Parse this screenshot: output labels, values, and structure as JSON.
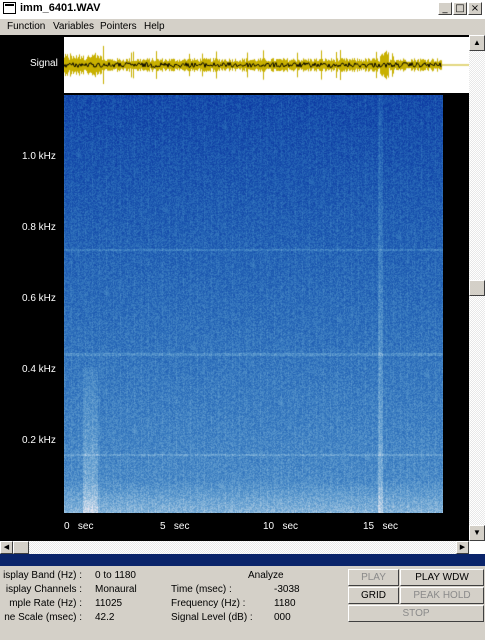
{
  "window": {
    "title": "imm_6401.WAV",
    "controls": {
      "minimize": "_",
      "maximize": "□",
      "close": "×"
    }
  },
  "menu": [
    {
      "label": "Function"
    },
    {
      "label": "Variables"
    },
    {
      "label": "Pointers"
    },
    {
      "label": "Help"
    }
  ],
  "plot": {
    "signal_label": "Signal",
    "y_ticks": [
      "1.0 kHz",
      "0.8 kHz",
      "0.6 kHz",
      "0.4 kHz",
      "0.2 kHz"
    ],
    "x_ticks": [
      "0   sec",
      "5   sec",
      "10   sec",
      "15   sec"
    ]
  },
  "chart_data": {
    "type": "heatmap",
    "title": "",
    "xlabel": "",
    "ylabel": "",
    "x_unit": "sec",
    "y_unit": "kHz",
    "xlim": [
      0,
      19
    ],
    "ylim": [
      0,
      1.18
    ],
    "x_ticks": [
      0,
      5,
      10,
      15
    ],
    "y_ticks": [
      0.2,
      0.4,
      0.6,
      0.8,
      1.0
    ]
  },
  "info": {
    "display_band_label": "isplay Band (Hz) :",
    "display_band_value": "0 to 1180",
    "display_channels_label": "isplay Channels :",
    "display_channels_value": "Monaural",
    "sample_rate_label": "mple Rate (Hz) :",
    "sample_rate_value": "11025",
    "time_scale_label": "ne Scale (msec) :",
    "time_scale_value": "42.2"
  },
  "analyze": {
    "title": "Analyze",
    "time_label": "Time (msec) :",
    "time_value": "-3038",
    "frequency_label": "Frequency (Hz) :",
    "frequency_value": "1180",
    "signal_level_label": "Signal Level (dB) :",
    "signal_level_value": "000"
  },
  "controls": {
    "play": "PLAY",
    "play_wdw": "PLAY WDW",
    "grid": "GRID",
    "peak_hold": "PEAK HOLD",
    "stop": "STOP"
  }
}
